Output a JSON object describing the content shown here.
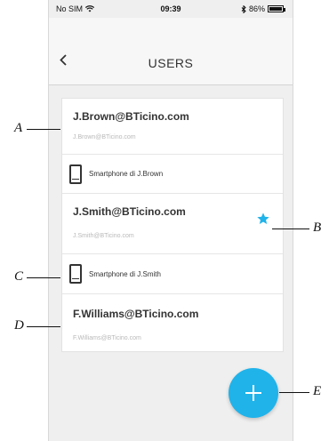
{
  "status_bar": {
    "carrier": "No SIM",
    "time": "09:39",
    "battery": "86%"
  },
  "header": {
    "title": "USERS",
    "back_icon": "chevron-left-icon"
  },
  "users": [
    {
      "email": "J.Brown@BTicino.com",
      "sub": "J.Brown@BTicino.com",
      "device": "Smartphone di J.Brown",
      "favorite": false
    },
    {
      "email": "J.Smith@BTicino.com",
      "sub": "J.Smith@BTicino.com",
      "device": "Smartphone di J.Smith",
      "favorite": true
    },
    {
      "email": "F.Williams@BTicino.com",
      "sub": "F.Williams@BTicino.com",
      "device": null,
      "favorite": false
    }
  ],
  "fab": {
    "icon": "plus-icon"
  },
  "callouts": [
    "A",
    "B",
    "C",
    "D",
    "E"
  ],
  "colors": {
    "accent": "#1fb3ea",
    "background": "#efefef"
  }
}
